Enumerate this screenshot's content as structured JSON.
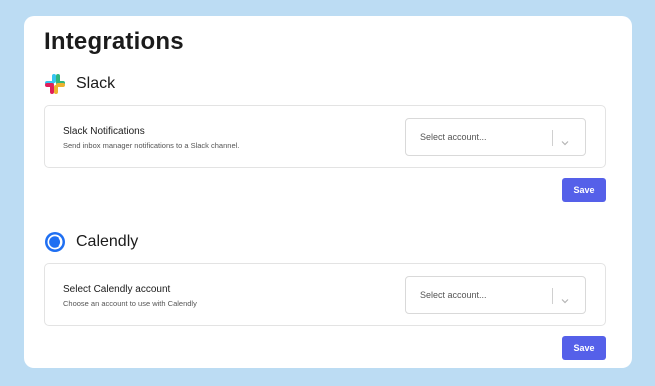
{
  "page": {
    "title": "Integrations"
  },
  "slack": {
    "name": "Slack",
    "card_title": "Slack Notifications",
    "card_desc": "Send inbox manager notifications to a Slack channel.",
    "select_placeholder": "Select account...",
    "save_label": "Save"
  },
  "calendly": {
    "name": "Calendly",
    "card_title": "Select Calendly account",
    "card_desc": "Choose an account to use with Calendly",
    "select_placeholder": "Select account...",
    "save_label": "Save"
  },
  "colors": {
    "background": "#bcdcf3",
    "panel": "#ffffff",
    "accent": "#5560e9",
    "calendly_blue": "#1f6ff2"
  },
  "icons": {
    "slack": "slack-logo-icon",
    "calendly": "calendly-logo-icon",
    "dropdown": "chevron-down-icon"
  }
}
